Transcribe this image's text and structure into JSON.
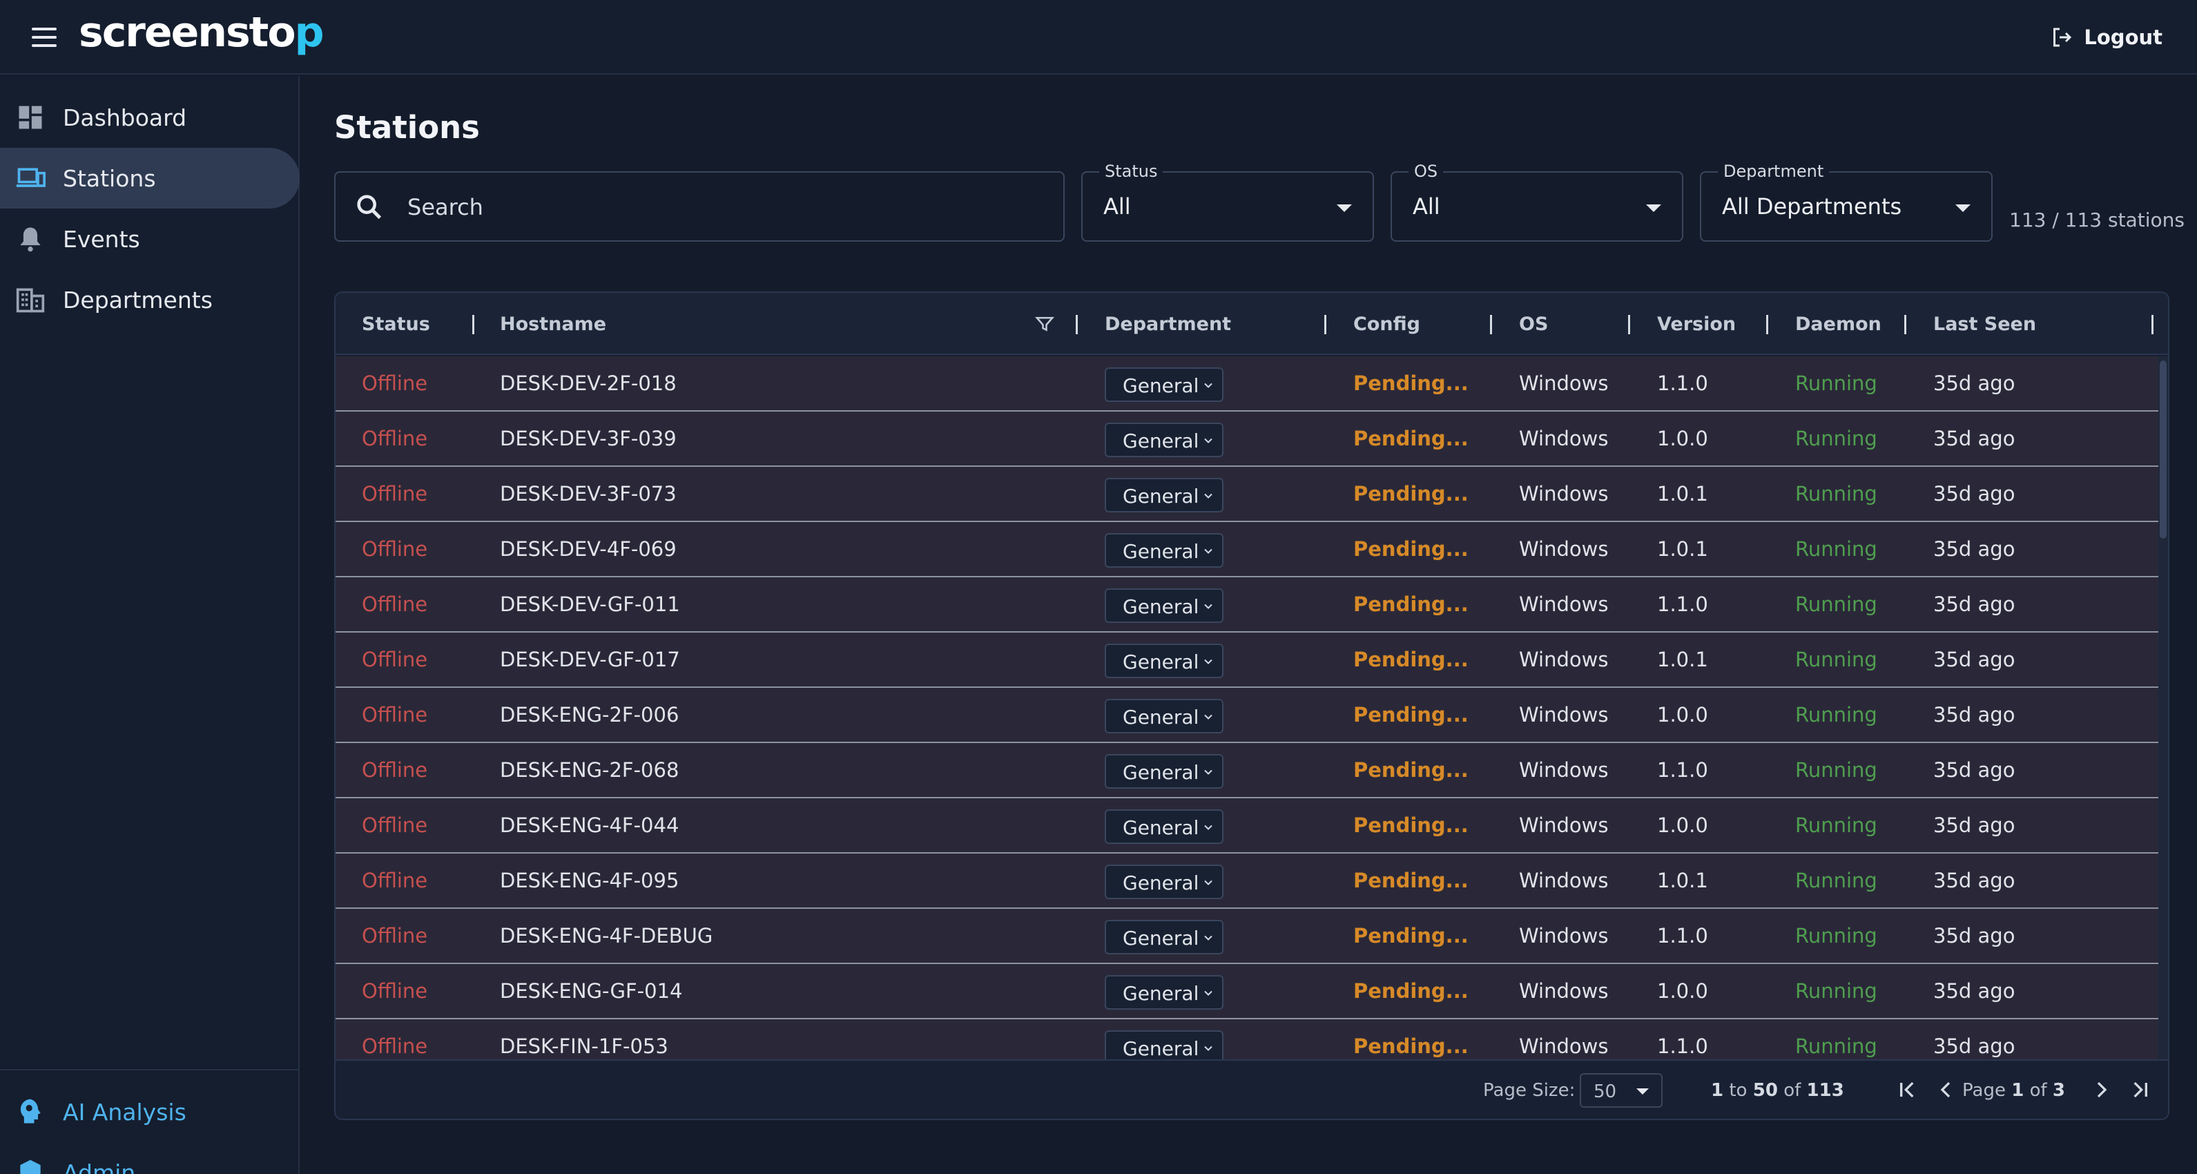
{
  "app": {
    "logo_main": "screensto",
    "logo_accent": "p",
    "logout_label": "Logout"
  },
  "sidebar": {
    "items": [
      {
        "label": "Dashboard",
        "icon": "dashboard-icon"
      },
      {
        "label": "Stations",
        "icon": "devices-icon",
        "active": true
      },
      {
        "label": "Events",
        "icon": "bell-icon"
      },
      {
        "label": "Departments",
        "icon": "building-icon"
      }
    ],
    "bottom_items": [
      {
        "label": "AI Analysis",
        "icon": "ai-brain-icon"
      },
      {
        "label": "Admin",
        "icon": "admin-icon"
      }
    ]
  },
  "page": {
    "title": "Stations"
  },
  "filters": {
    "search_placeholder": "Search",
    "status_label": "Status",
    "status_value": "All",
    "os_label": "OS",
    "os_value": "All",
    "department_label": "Department",
    "department_value": "All Departments",
    "count_text": "113 / 113 stations"
  },
  "table": {
    "columns": [
      "Status",
      "Hostname",
      "Department",
      "Config",
      "OS",
      "Version",
      "Daemon",
      "Last Seen"
    ],
    "rows": [
      {
        "status": "Offline",
        "hostname": "DESK-DEV-2F-018",
        "department": "General",
        "config": "Pending...",
        "os": "Windows",
        "version": "1.1.0",
        "daemon": "Running",
        "last_seen": "35d ago"
      },
      {
        "status": "Offline",
        "hostname": "DESK-DEV-3F-039",
        "department": "General",
        "config": "Pending...",
        "os": "Windows",
        "version": "1.0.0",
        "daemon": "Running",
        "last_seen": "35d ago"
      },
      {
        "status": "Offline",
        "hostname": "DESK-DEV-3F-073",
        "department": "General",
        "config": "Pending...",
        "os": "Windows",
        "version": "1.0.1",
        "daemon": "Running",
        "last_seen": "35d ago"
      },
      {
        "status": "Offline",
        "hostname": "DESK-DEV-4F-069",
        "department": "General",
        "config": "Pending...",
        "os": "Windows",
        "version": "1.0.1",
        "daemon": "Running",
        "last_seen": "35d ago"
      },
      {
        "status": "Offline",
        "hostname": "DESK-DEV-GF-011",
        "department": "General",
        "config": "Pending...",
        "os": "Windows",
        "version": "1.1.0",
        "daemon": "Running",
        "last_seen": "35d ago"
      },
      {
        "status": "Offline",
        "hostname": "DESK-DEV-GF-017",
        "department": "General",
        "config": "Pending...",
        "os": "Windows",
        "version": "1.0.1",
        "daemon": "Running",
        "last_seen": "35d ago"
      },
      {
        "status": "Offline",
        "hostname": "DESK-ENG-2F-006",
        "department": "General",
        "config": "Pending...",
        "os": "Windows",
        "version": "1.0.0",
        "daemon": "Running",
        "last_seen": "35d ago"
      },
      {
        "status": "Offline",
        "hostname": "DESK-ENG-2F-068",
        "department": "General",
        "config": "Pending...",
        "os": "Windows",
        "version": "1.1.0",
        "daemon": "Running",
        "last_seen": "35d ago"
      },
      {
        "status": "Offline",
        "hostname": "DESK-ENG-4F-044",
        "department": "General",
        "config": "Pending...",
        "os": "Windows",
        "version": "1.0.0",
        "daemon": "Running",
        "last_seen": "35d ago"
      },
      {
        "status": "Offline",
        "hostname": "DESK-ENG-4F-095",
        "department": "General",
        "config": "Pending...",
        "os": "Windows",
        "version": "1.0.1",
        "daemon": "Running",
        "last_seen": "35d ago"
      },
      {
        "status": "Offline",
        "hostname": "DESK-ENG-4F-DEBUG",
        "department": "General",
        "config": "Pending...",
        "os": "Windows",
        "version": "1.1.0",
        "daemon": "Running",
        "last_seen": "35d ago"
      },
      {
        "status": "Offline",
        "hostname": "DESK-ENG-GF-014",
        "department": "General",
        "config": "Pending...",
        "os": "Windows",
        "version": "1.0.0",
        "daemon": "Running",
        "last_seen": "35d ago"
      },
      {
        "status": "Offline",
        "hostname": "DESK-FIN-1F-053",
        "department": "General",
        "config": "Pending...",
        "os": "Windows",
        "version": "1.1.0",
        "daemon": "Running",
        "last_seen": "35d ago"
      }
    ]
  },
  "pagination": {
    "page_size_label": "Page Size:",
    "page_size_value": "50",
    "range_from": "1",
    "range_to_word": "to",
    "range_to": "50",
    "of_word": "of",
    "range_total": "113",
    "page_word": "Page",
    "page_current": "1",
    "page_total": "3"
  },
  "colors": {
    "background": "#141c2b",
    "status_offline": "#c6504f",
    "config_pending": "#d78a28",
    "daemon_running": "#4f9e4f",
    "logo_accent": "#2ec4f0",
    "link_blue": "#4fb3ee"
  }
}
